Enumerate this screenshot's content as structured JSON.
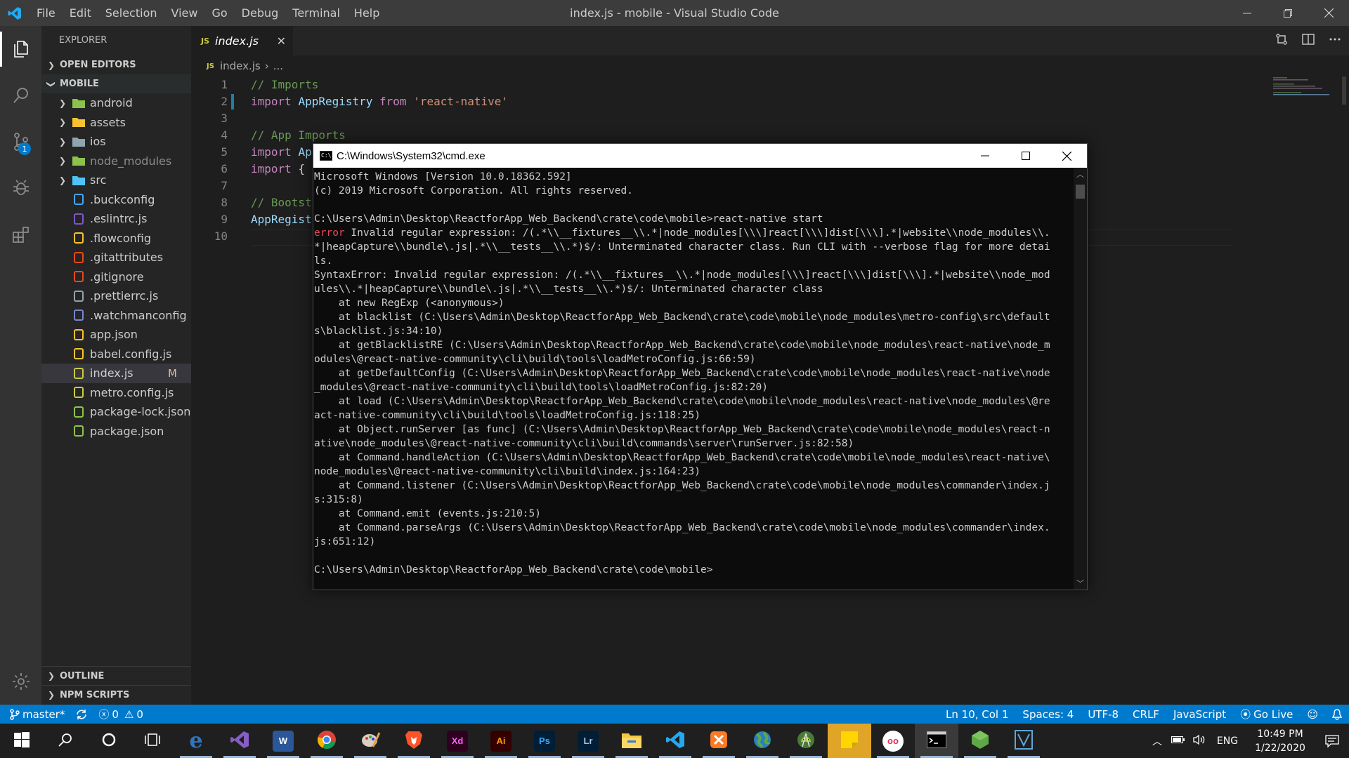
{
  "window": {
    "title": "index.js - mobile - Visual Studio Code",
    "menu": [
      "File",
      "Edit",
      "Selection",
      "View",
      "Go",
      "Debug",
      "Terminal",
      "Help"
    ]
  },
  "activity": {
    "scm_badge": "1"
  },
  "sidebar": {
    "title": "EXPLORER",
    "open_editors": "OPEN EDITORS",
    "root": "MOBILE",
    "items": [
      {
        "label": "android",
        "type": "folder",
        "icon_color": "#8bc34a"
      },
      {
        "label": "assets",
        "type": "folder",
        "icon_color": "#f9c22e"
      },
      {
        "label": "ios",
        "type": "folder",
        "icon_color": "#90a4ae"
      },
      {
        "label": "node_modules",
        "type": "folder",
        "icon_color": "#8bc34a"
      },
      {
        "label": "src",
        "type": "folder",
        "icon_color": "#4fc3f7"
      },
      {
        "label": ".buckconfig",
        "type": "file",
        "icon_color": "#42a5f5"
      },
      {
        "label": ".eslintrc.js",
        "type": "file",
        "icon_color": "#7e57c2"
      },
      {
        "label": ".flowconfig",
        "type": "file",
        "icon_color": "#f9c22e"
      },
      {
        "label": ".gitattributes",
        "type": "file",
        "icon_color": "#e64a19"
      },
      {
        "label": ".gitignore",
        "type": "file",
        "icon_color": "#e64a19"
      },
      {
        "label": ".prettierrc.js",
        "type": "file",
        "icon_color": "#90a4ae"
      },
      {
        "label": ".watchmanconfig",
        "type": "file",
        "icon_color": "#7986cb"
      },
      {
        "label": "app.json",
        "type": "file",
        "icon_color": "#f9c22e"
      },
      {
        "label": "babel.config.js",
        "type": "file",
        "icon_color": "#f9c22e"
      },
      {
        "label": "index.js",
        "type": "file",
        "icon_color": "#cbcb41",
        "modified": "M",
        "selected": true
      },
      {
        "label": "metro.config.js",
        "type": "file",
        "icon_color": "#cbcb41"
      },
      {
        "label": "package-lock.json",
        "type": "file",
        "icon_color": "#8bc34a"
      },
      {
        "label": "package.json",
        "type": "file",
        "icon_color": "#8bc34a"
      }
    ],
    "outline": "OUTLINE",
    "npm_scripts": "NPM SCRIPTS"
  },
  "editor": {
    "tab_label": "index.js",
    "breadcrumb_file": "index.js",
    "breadcrumb_more": "...",
    "lines": [
      {
        "n": "1",
        "tokens": [
          {
            "t": "// Imports",
            "c": "c-cmt"
          }
        ]
      },
      {
        "n": "2",
        "tokens": [
          {
            "t": "import ",
            "c": "c-kw"
          },
          {
            "t": "AppRegistry ",
            "c": "c-id"
          },
          {
            "t": "from ",
            "c": "c-kw"
          },
          {
            "t": "'react-native'",
            "c": "c-str"
          }
        ]
      },
      {
        "n": "3",
        "tokens": []
      },
      {
        "n": "4",
        "tokens": [
          {
            "t": "// App Imports",
            "c": "c-cmt"
          }
        ]
      },
      {
        "n": "5",
        "tokens": [
          {
            "t": "import ",
            "c": "c-kw"
          },
          {
            "t": "Ap",
            "c": "c-id"
          }
        ]
      },
      {
        "n": "6",
        "tokens": [
          {
            "t": "import ",
            "c": "c-kw"
          },
          {
            "t": "{ ",
            "c": "c-plain"
          },
          {
            "t": "n",
            "c": "c-id"
          }
        ]
      },
      {
        "n": "7",
        "tokens": []
      },
      {
        "n": "8",
        "tokens": [
          {
            "t": "// Bootst",
            "c": "c-cmt"
          }
        ]
      },
      {
        "n": "9",
        "tokens": [
          {
            "t": "AppRegist",
            "c": "c-id"
          }
        ]
      },
      {
        "n": "10",
        "tokens": []
      }
    ]
  },
  "cmd": {
    "title": "C:\\Windows\\System32\\cmd.exe",
    "lines": [
      {
        "t": "Microsoft Windows [Version 10.0.18362.592]"
      },
      {
        "t": "(c) 2019 Microsoft Corporation. All rights reserved."
      },
      {
        "t": ""
      },
      {
        "t": "C:\\Users\\Admin\\Desktop\\ReactforApp_Web_Backend\\crate\\code\\mobile>react-native start"
      },
      {
        "err": "error",
        "t": " Invalid regular expression: /(.*\\\\__fixtures__\\\\.*|node_modules[\\\\\\]react[\\\\\\]dist[\\\\\\].*|website\\\\node_modules\\\\."
      },
      {
        "t": "*|heapCapture\\\\bundle\\.js|.*\\\\__tests__\\\\.*)$/: Unterminated character class. Run CLI with --verbose flag for more detai"
      },
      {
        "t": "ls."
      },
      {
        "t": "SyntaxError: Invalid regular expression: /(.*\\\\__fixtures__\\\\.*|node_modules[\\\\\\]react[\\\\\\]dist[\\\\\\].*|website\\\\node_mod"
      },
      {
        "t": "ules\\\\.*|heapCapture\\\\bundle\\.js|.*\\\\__tests__\\\\.*)$/: Unterminated character class"
      },
      {
        "t": "    at new RegExp (<anonymous>)"
      },
      {
        "t": "    at blacklist (C:\\Users\\Admin\\Desktop\\ReactforApp_Web_Backend\\crate\\code\\mobile\\node_modules\\metro-config\\src\\default"
      },
      {
        "t": "s\\blacklist.js:34:10)"
      },
      {
        "t": "    at getBlacklistRE (C:\\Users\\Admin\\Desktop\\ReactforApp_Web_Backend\\crate\\code\\mobile\\node_modules\\react-native\\node_m"
      },
      {
        "t": "odules\\@react-native-community\\cli\\build\\tools\\loadMetroConfig.js:66:59)"
      },
      {
        "t": "    at getDefaultConfig (C:\\Users\\Admin\\Desktop\\ReactforApp_Web_Backend\\crate\\code\\mobile\\node_modules\\react-native\\node"
      },
      {
        "t": "_modules\\@react-native-community\\cli\\build\\tools\\loadMetroConfig.js:82:20)"
      },
      {
        "t": "    at load (C:\\Users\\Admin\\Desktop\\ReactforApp_Web_Backend\\crate\\code\\mobile\\node_modules\\react-native\\node_modules\\@re"
      },
      {
        "t": "act-native-community\\cli\\build\\tools\\loadMetroConfig.js:118:25)"
      },
      {
        "t": "    at Object.runServer [as func] (C:\\Users\\Admin\\Desktop\\ReactforApp_Web_Backend\\crate\\code\\mobile\\node_modules\\react-n"
      },
      {
        "t": "ative\\node_modules\\@react-native-community\\cli\\build\\commands\\server\\runServer.js:82:58)"
      },
      {
        "t": "    at Command.handleAction (C:\\Users\\Admin\\Desktop\\ReactforApp_Web_Backend\\crate\\code\\mobile\\node_modules\\react-native\\"
      },
      {
        "t": "node_modules\\@react-native-community\\cli\\build\\index.js:164:23)"
      },
      {
        "t": "    at Command.listener (C:\\Users\\Admin\\Desktop\\ReactforApp_Web_Backend\\crate\\code\\mobile\\node_modules\\commander\\index.j"
      },
      {
        "t": "s:315:8)"
      },
      {
        "t": "    at Command.emit (events.js:210:5)"
      },
      {
        "t": "    at Command.parseArgs (C:\\Users\\Admin\\Desktop\\ReactforApp_Web_Backend\\crate\\code\\mobile\\node_modules\\commander\\index."
      },
      {
        "t": "js:651:12)"
      },
      {
        "t": ""
      },
      {
        "t": "C:\\Users\\Admin\\Desktop\\ReactforApp_Web_Backend\\crate\\code\\mobile>"
      }
    ]
  },
  "statusbar": {
    "branch": "master*",
    "errors": "0",
    "warnings": "0",
    "position": "Ln 10, Col 1",
    "spaces": "Spaces: 4",
    "encoding": "UTF-8",
    "eol": "CRLF",
    "language": "JavaScript",
    "golive": "Go Live"
  },
  "taskbar": {
    "apps": [
      {
        "name": "start-button",
        "label": "",
        "bg": "",
        "fg": "#ffffff"
      },
      {
        "name": "search-button",
        "label": "",
        "bg": "",
        "fg": "#ffffff"
      },
      {
        "name": "cortana-button",
        "label": "",
        "bg": "",
        "fg": "#ffffff"
      },
      {
        "name": "task-view-button",
        "label": "",
        "bg": "",
        "fg": "#ffffff"
      },
      {
        "name": "edge-app",
        "label": "e",
        "bg": "",
        "fg": "#3277bc"
      },
      {
        "name": "visual-studio-app",
        "label": "",
        "bg": "",
        "fg": "#865fc5"
      },
      {
        "name": "word-app",
        "label": "W",
        "bg": "#2b579a",
        "fg": "#ffffff"
      },
      {
        "name": "chrome-app",
        "label": "",
        "bg": "",
        "fg": "#ffffff"
      },
      {
        "name": "paint-app",
        "label": "",
        "bg": "",
        "fg": "#ffffff"
      },
      {
        "name": "brave-app",
        "label": "",
        "bg": "",
        "fg": "#fb542b"
      },
      {
        "name": "adobe-xd-app",
        "label": "Xd",
        "bg": "#2e001f",
        "fg": "#ff61f6"
      },
      {
        "name": "illustrator-app",
        "label": "Ai",
        "bg": "#330000",
        "fg": "#ff9a00"
      },
      {
        "name": "photoshop-app",
        "label": "Ps",
        "bg": "#001e36",
        "fg": "#31a8ff"
      },
      {
        "name": "lightroom-app",
        "label": "Lr",
        "bg": "#001e36",
        "fg": "#9cc5e8"
      },
      {
        "name": "file-explorer-app",
        "label": "",
        "bg": "",
        "fg": "#f8c73c"
      },
      {
        "name": "vscode-app",
        "label": "",
        "bg": "",
        "fg": "#23a9f2"
      },
      {
        "name": "xampp-app",
        "label": "",
        "bg": "",
        "fg": "#fb7a24"
      },
      {
        "name": "globe-app",
        "label": "",
        "bg": "",
        "fg": "#5fa847"
      },
      {
        "name": "android-studio-app",
        "label": "",
        "bg": "",
        "fg": "#78c257"
      },
      {
        "name": "sticky-notes-app",
        "label": "",
        "bg": "",
        "fg": "#ffd500"
      },
      {
        "name": "flickr-app",
        "label": "oo",
        "bg": "#ffffff",
        "fg": "#e7304f"
      },
      {
        "name": "cmd-app",
        "label": "",
        "bg": "",
        "fg": "#ffffff"
      },
      {
        "name": "node-app",
        "label": "",
        "bg": "",
        "fg": "#5fa847"
      },
      {
        "name": "app-installer-app",
        "label": "",
        "bg": "",
        "fg": "#5ea5d6"
      }
    ],
    "language": "ENG",
    "time": "10:49 PM",
    "date": "1/22/2020"
  }
}
